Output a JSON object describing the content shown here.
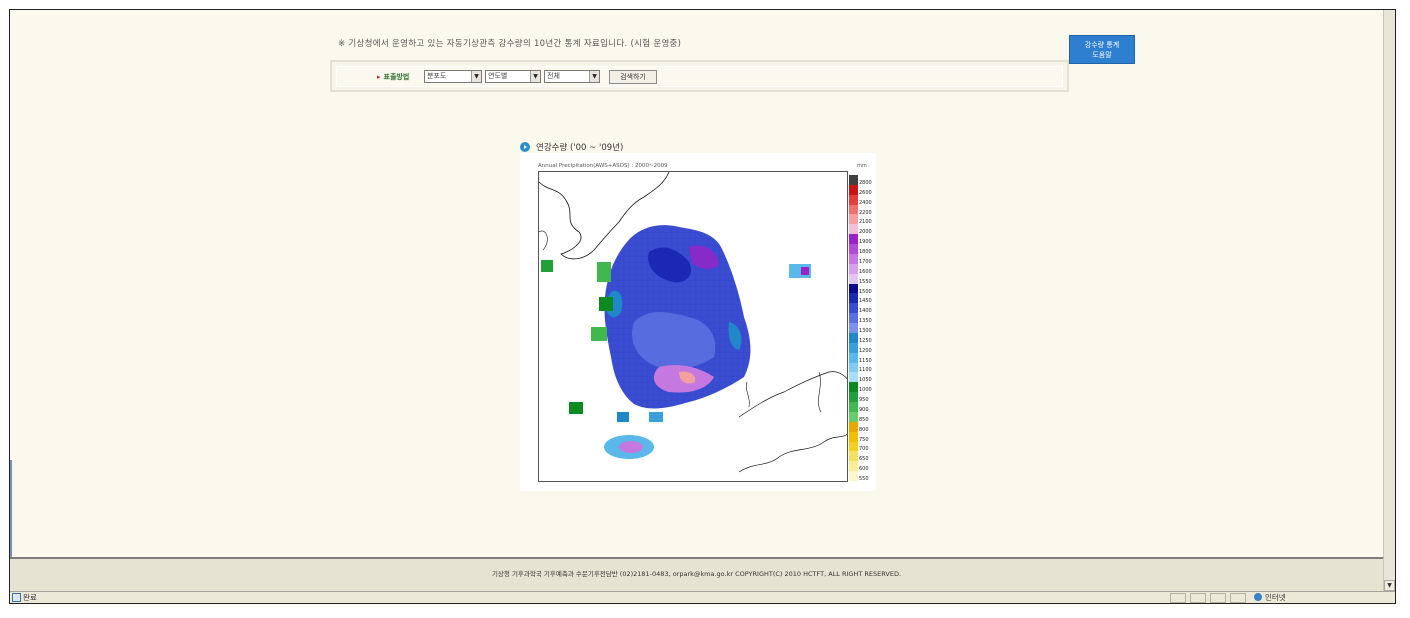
{
  "notice": "※ 기상청에서 운영하고 있는 자동기상관측 강수량의 10년간 통계 자료입니다. (시험 운영중)",
  "help_button": {
    "line1": "강수량 통계",
    "line2": "도움말"
  },
  "search": {
    "method_label": "표출방법",
    "type_select": "분포도",
    "period_select": "연도별",
    "region_select": "전체",
    "search_button": "검색하기"
  },
  "map": {
    "title": "연강수량 ('00 ~ '09년)",
    "caption": "Annual Precipitation(AWS+ASOS) : 2000~2009",
    "unit": "mm",
    "colorbar_labels": [
      "2800",
      "2600",
      "2400",
      "2200",
      "2100",
      "2000",
      "1900",
      "1800",
      "1700",
      "1600",
      "1550",
      "1500",
      "1450",
      "1400",
      "1350",
      "1300",
      "1250",
      "1200",
      "1150",
      "1100",
      "1050",
      "1000",
      "950",
      "900",
      "850",
      "800",
      "750",
      "700",
      "650",
      "600",
      "550"
    ],
    "colorbar_colors": [
      "#404040",
      "#c81414",
      "#e63c3c",
      "#f07070",
      "#f4a0a0",
      "#f4c0d8",
      "#9a22c8",
      "#b04cd6",
      "#c478e0",
      "#d6a0ea",
      "#e4c4f2",
      "#0a0a8c",
      "#1a28b4",
      "#3a4cd2",
      "#5a70e0",
      "#7c92ea",
      "#2088c8",
      "#3aa0da",
      "#5ab8ea",
      "#80ccf2",
      "#a8def8",
      "#0a8a20",
      "#20a03a",
      "#40b84e",
      "#68cc6a",
      "#e8a800",
      "#f0c000",
      "#f4d020",
      "#f8e060",
      "#fcec98",
      "#fef6cc"
    ]
  },
  "footer": "기상청 기후과학국 기후예측과 수문기후전담반  (02)2181-0483, orpark@kma.go.kr   COPYRIGHT(C) 2010 HCTFT, ALL RIGHT RESERVED.",
  "statusbar": {
    "status": "완료",
    "zone": "인터넷"
  }
}
